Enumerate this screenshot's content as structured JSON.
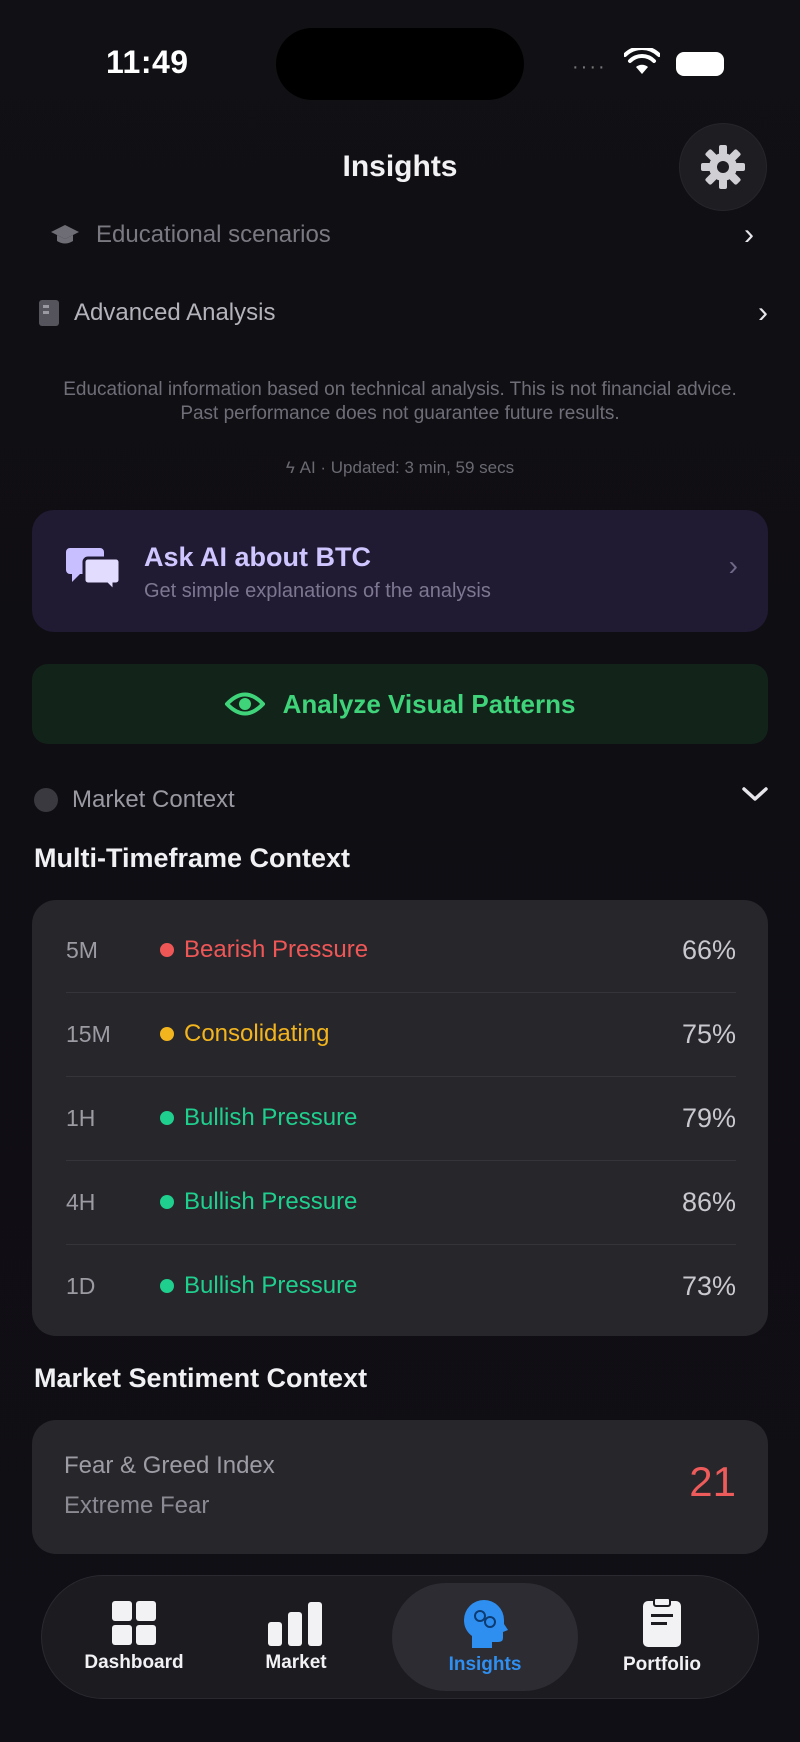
{
  "status_bar": {
    "time": "11:49"
  },
  "header": {
    "title": "Insights"
  },
  "links": {
    "educational": "Educational scenarios",
    "advanced": "Advanced Analysis"
  },
  "disclaimer": "Educational information based on technical analysis. This is not financial advice. Past performance does not guarantee future results.",
  "updated": "AI · Updated: 3 min, 59 secs",
  "ask_ai": {
    "title": "Ask AI about BTC",
    "subtitle": "Get simple explanations of the analysis"
  },
  "analyze_label": "Analyze Visual Patterns",
  "market_context": {
    "label": "Market Context"
  },
  "multi_timeframe": {
    "title": "Multi-Timeframe Context",
    "rows": [
      {
        "tf": "5M",
        "signal": "Bearish Pressure",
        "pct": "66%",
        "color": "#ef5757"
      },
      {
        "tf": "15M",
        "signal": "Consolidating",
        "pct": "75%",
        "color": "#f2b51e"
      },
      {
        "tf": "1H",
        "signal": "Bullish Pressure",
        "pct": "79%",
        "color": "#1fcf8e"
      },
      {
        "tf": "4H",
        "signal": "Bullish Pressure",
        "pct": "86%",
        "color": "#1fcf8e"
      },
      {
        "tf": "1D",
        "signal": "Bullish Pressure",
        "pct": "73%",
        "color": "#1fcf8e"
      }
    ]
  },
  "sentiment": {
    "title": "Market Sentiment Context",
    "label": "Fear & Greed Index",
    "state": "Extreme Fear",
    "value": "21"
  },
  "tabs": [
    {
      "label": "Dashboard",
      "icon": "grid-icon"
    },
    {
      "label": "Market",
      "icon": "bar-chart-icon"
    },
    {
      "label": "Insights",
      "icon": "brain-head-icon",
      "active": true
    },
    {
      "label": "Portfolio",
      "icon": "document-icon"
    }
  ]
}
